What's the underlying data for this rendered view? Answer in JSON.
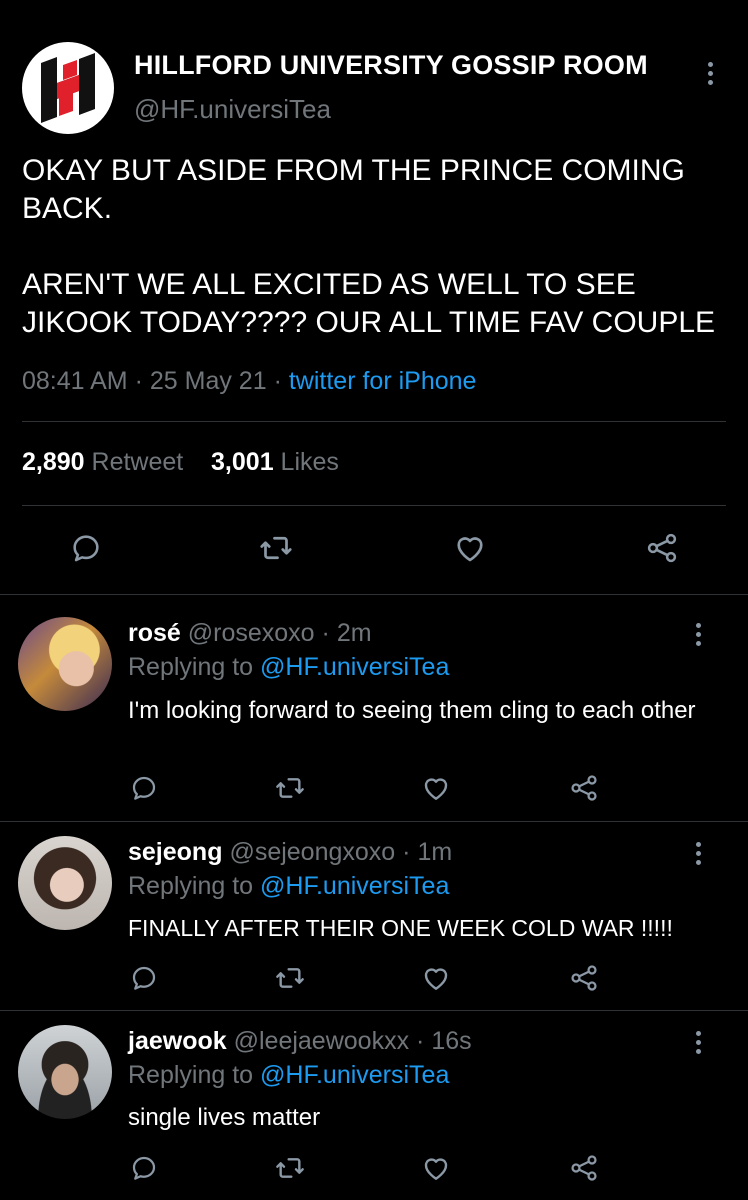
{
  "main_tweet": {
    "display_name": "HILLFORD UNIVERSITY GOSSIP ROOM",
    "handle": "@HF.universiTea",
    "text": "OKAY BUT ASIDE FROM THE PRINCE COMING BACK.\n\nAREN'T WE ALL EXCITED AS WELL TO SEE JIKOOK TODAY???? OUR ALL TIME FAV COUPLE",
    "time": "08:41 AM",
    "date": "25 May 21",
    "separator": "·",
    "source": "twitter for iPhone",
    "retweets_count": "2,890",
    "retweets_label": "Retweet",
    "likes_count": "3,001",
    "likes_label": "Likes",
    "avatar_icon": "hillford-logo-icon",
    "accent_color": "#e0202a"
  },
  "replies": [
    {
      "display_name": "rosé",
      "handle": "@rosexoxo",
      "separator": "·",
      "time_ago": "2m",
      "replying_prefix": "Replying to",
      "replying_to": "@HF.universiTea",
      "text": "I'm looking forward to seeing them cling to each other"
    },
    {
      "display_name": "sejeong",
      "handle": "@sejeongxoxo",
      "separator": "·",
      "time_ago": "1m",
      "replying_prefix": "Replying to",
      "replying_to": "@HF.universiTea",
      "text": "FINALLY AFTER THEIR ONE WEEK COLD WAR !!!!!"
    },
    {
      "display_name": "jaewook",
      "handle": "@leejaewookxx",
      "separator": "·",
      "time_ago": "16s",
      "replying_prefix": "Replying to",
      "replying_to": "@HF.universiTea",
      "text": "single lives matter"
    }
  ],
  "colors": {
    "background": "#000000",
    "text": "#ffffff",
    "muted": "#71767b",
    "link": "#1d9bf0",
    "divider": "#2f3336"
  }
}
